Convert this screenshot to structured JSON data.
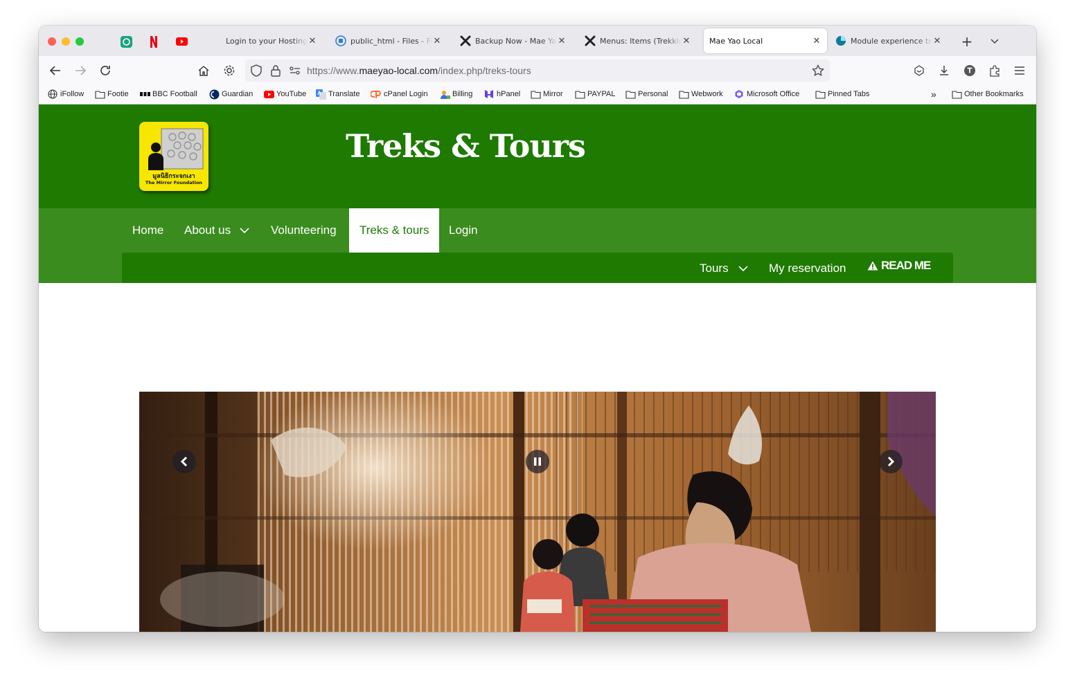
{
  "browser": {
    "tabs": [
      {
        "label": "Login to your Hostinger acc",
        "icon": "hostinger-icon",
        "active": false
      },
      {
        "label": "public_html - Files - File",
        "icon": "files-icon",
        "active": false
      },
      {
        "label": "Backup Now - Mae Yao",
        "icon": "joomla-icon",
        "active": false
      },
      {
        "label": "Menus: Items (Trekking",
        "icon": "joomla-icon",
        "active": false
      },
      {
        "label": "Mae Yao Local",
        "icon": "",
        "active": true
      },
      {
        "label": "Module experience trac",
        "icon": "module-icon",
        "active": false
      }
    ],
    "url_prefix": "https://www.",
    "url_domain": "maeyao-local.com",
    "url_path": "/index.php/treks-tours",
    "bookmarks": [
      {
        "label": "iFollow",
        "icon": "globe-icon"
      },
      {
        "label": "Footie",
        "icon": "folder-icon"
      },
      {
        "label": "BBC Football",
        "icon": "bbc-icon"
      },
      {
        "label": "Guardian",
        "icon": "guardian-icon"
      },
      {
        "label": "YouTube",
        "icon": "youtube-icon"
      },
      {
        "label": "Translate",
        "icon": "translate-icon"
      },
      {
        "label": "cPanel Login",
        "icon": "cpanel-icon"
      },
      {
        "label": "Billing",
        "icon": "billing-icon"
      },
      {
        "label": "hPanel",
        "icon": "hpanel-icon"
      },
      {
        "label": "Mirror",
        "icon": "folder-icon"
      },
      {
        "label": "PAYPAL",
        "icon": "folder-icon"
      },
      {
        "label": "Personal",
        "icon": "folder-icon"
      },
      {
        "label": "Webwork",
        "icon": "folder-icon"
      },
      {
        "label": "Microsoft Office",
        "icon": "office-icon"
      },
      {
        "label": "Pinned Tabs",
        "icon": "folder-icon"
      }
    ],
    "other_bookmarks": "Other Bookmarks"
  },
  "site": {
    "title": "Treks & Tours",
    "logo_thai": "มูลนิธิกระจกเงา",
    "logo_en": "The Mirror Foundation",
    "nav": [
      {
        "label": "Home",
        "has_dropdown": false,
        "active": false
      },
      {
        "label": "About us",
        "has_dropdown": true,
        "active": false
      },
      {
        "label": "Volunteering",
        "has_dropdown": false,
        "active": false
      },
      {
        "label": "Treks & tours",
        "has_dropdown": false,
        "active": true
      },
      {
        "label": "Login",
        "has_dropdown": false,
        "active": false
      }
    ],
    "subnav": {
      "tours": "Tours",
      "reservation": "My reservation",
      "readme": "READ ME"
    }
  },
  "colors": {
    "header_green": "#1e7a00",
    "nav_green": "#3b8c1e"
  }
}
